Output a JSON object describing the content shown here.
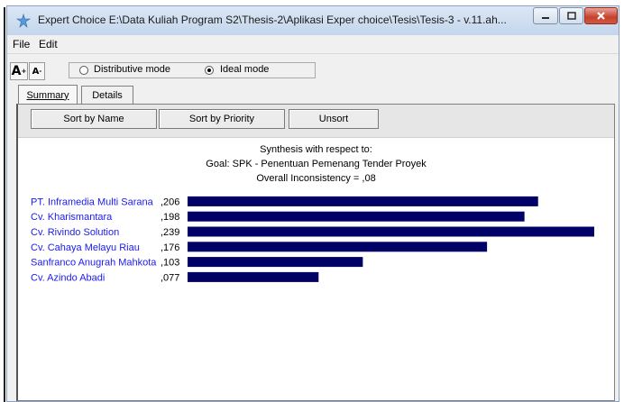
{
  "window": {
    "title": "Expert Choice    E:\\Data Kuliah Program S2\\Thesis-2\\Aplikasi Exper choice\\Tesis\\Tesis-3 - v.11.ah..."
  },
  "menu": {
    "file": "File",
    "edit": "Edit"
  },
  "toolbar": {
    "font_increase": "A",
    "font_decrease": "A",
    "distributive_label": "Distributive mode",
    "ideal_label": "Ideal mode",
    "selected_mode": "ideal"
  },
  "tabs": {
    "summary": "Summary",
    "details": "Details"
  },
  "sort": {
    "by_name": "Sort by Name",
    "by_priority": "Sort by Priority",
    "unsort": "Unsort"
  },
  "synthesis": {
    "line1": "Synthesis with respect to:",
    "line2": "Goal: SPK - Penentuan Pemenang Tender Proyek",
    "line3": "Overall Inconsistency = ,08"
  },
  "colors": {
    "bar": "#000066",
    "label": "#1a1aee",
    "close_button": "#c7402b"
  },
  "chart_data": {
    "type": "bar",
    "orientation": "horizontal",
    "categories": [
      "PT. Inframedia Multi Sarana",
      "Cv. Kharismantara",
      "Cv.  Rivindo Solution",
      "Cv. Cahaya Melayu Riau",
      "Sanfranco Anugrah Mahkota",
      "Cv. Azindo Abadi"
    ],
    "values": [
      0.206,
      0.198,
      0.239,
      0.176,
      0.103,
      0.077
    ],
    "value_labels": [
      ",206",
      ",198",
      ",239",
      ",176",
      ",103",
      ",077"
    ],
    "xlim": [
      0,
      0.239
    ],
    "grid": false
  }
}
